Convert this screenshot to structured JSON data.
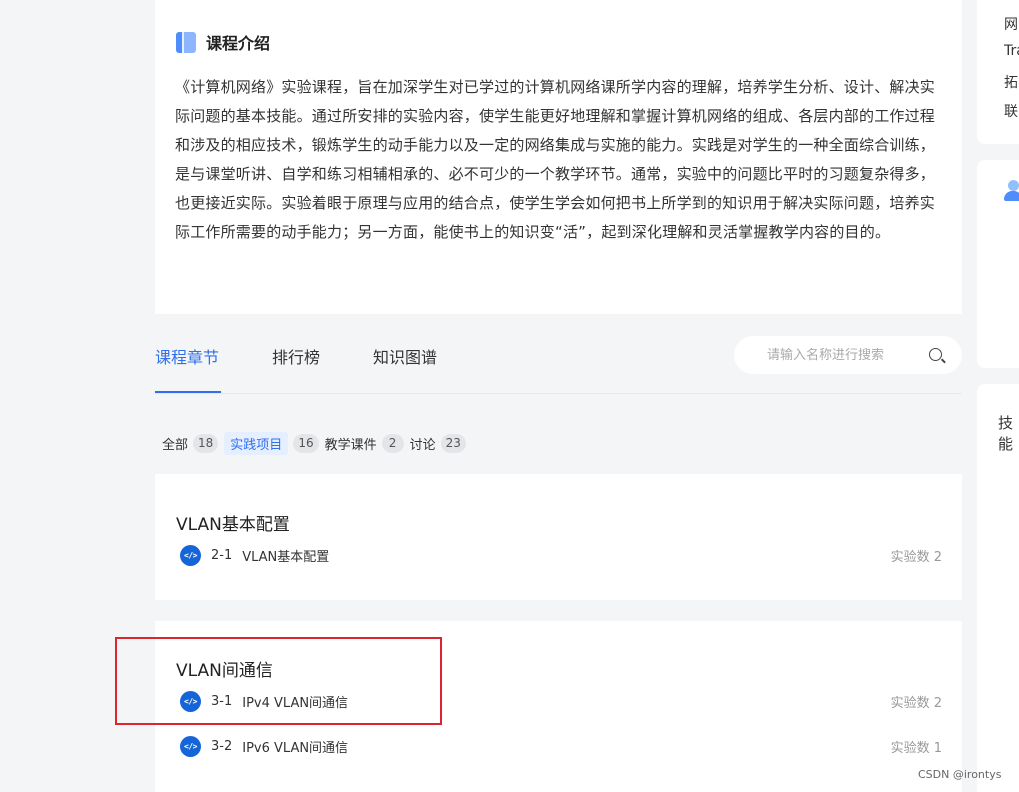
{
  "intro": {
    "title": "课程介绍",
    "text": "《计算机网络》实验课程，旨在加深学生对已学过的计算机网络课所学内容的理解，培养学生分析、设计、解决实际问题的基本技能。通过所安排的实验内容，使学生能更好地理解和掌握计算机网络的组成、各层内部的工作过程和涉及的相应技术，锻炼学生的动手能力以及一定的网络集成与实施的能力。实践是对学生的一种全面综合训练，是与课堂听讲、自学和练习相辅相承的、必不可少的一个教学环节。通常，实验中的问题比平时的习题复杂得多，也更接近实际。实验着眼于原理与应用的结合点，使学生学会如何把书上所学到的知识用于解决实际问题，培养实际工作所需要的动手能力；另一方面，能使书上的知识变“活”，起到深化理解和灵活掌握教学内容的目的。"
  },
  "tabs": [
    {
      "label": "课程章节",
      "active": true
    },
    {
      "label": "排行榜",
      "active": false
    },
    {
      "label": "知识图谱",
      "active": false
    }
  ],
  "search": {
    "placeholder": "请输入名称进行搜索",
    "value": ""
  },
  "filters": [
    {
      "label": "全部",
      "count": "18"
    },
    {
      "label": "实践项目",
      "count": "16",
      "active": true
    },
    {
      "label": "教学课件",
      "count": "2"
    },
    {
      "label": "讨论",
      "count": "23"
    }
  ],
  "chapters": [
    {
      "title": "VLAN基本配置",
      "lessons": [
        {
          "icon": "code-icon",
          "num": "2-1",
          "name": "VLAN基本配置",
          "count": "实验数 2"
        }
      ]
    },
    {
      "title": "VLAN间通信",
      "lessons": [
        {
          "icon": "code-icon",
          "num": "3-1",
          "name": "IPv4 VLAN间通信",
          "count": "实验数 2"
        },
        {
          "icon": "code-icon",
          "num": "3-2",
          "name": "IPv6 VLAN间通信",
          "count": "实验数 1"
        }
      ]
    }
  ],
  "sidebar": {
    "lines": [
      "网",
      "Tra",
      "拓",
      "联"
    ],
    "skill_label": "技能"
  },
  "icon_glyph": "</>",
  "watermark": "CSDN @irontys",
  "colors": {
    "accent": "#2f6fed",
    "highlight": "#d9262f",
    "lesson_icon": "#1565d8"
  }
}
